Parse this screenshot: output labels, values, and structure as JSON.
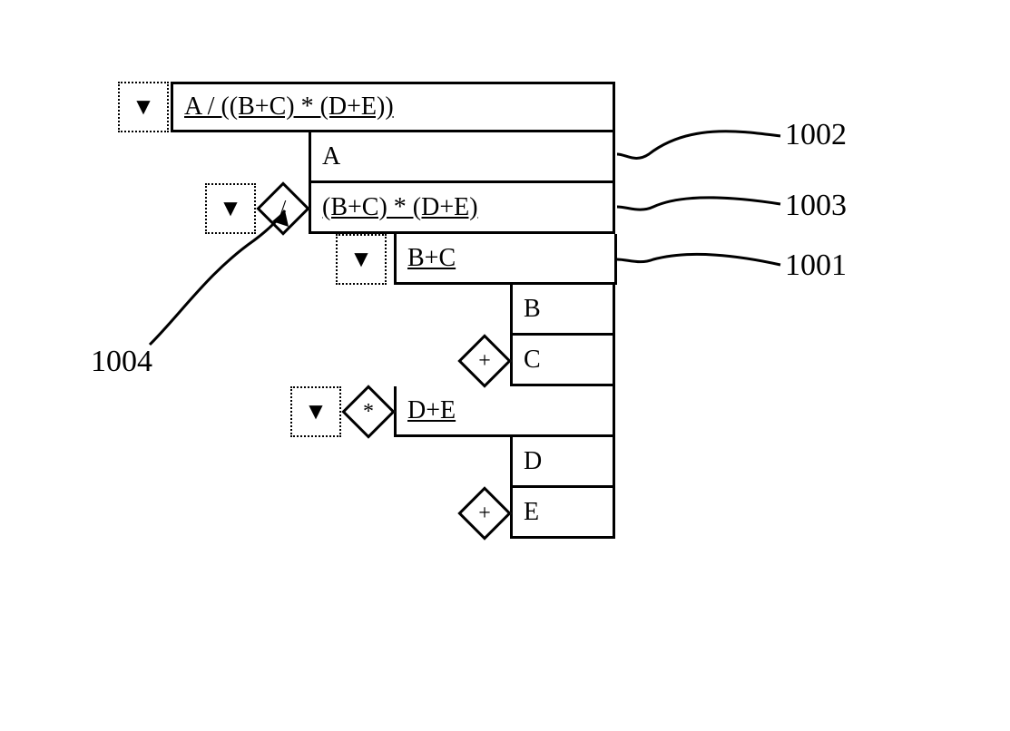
{
  "tree": {
    "root_expr": "A / ((B+C) * (D+E))",
    "node_A": "A",
    "expr_bc_de": "(B+C) * (D+E)",
    "op_div": "/",
    "expr_bc": "B+C",
    "node_B": "B",
    "node_C": "C",
    "op_plus1": "+",
    "op_mul": "*",
    "expr_de": "D+E",
    "node_D": "D",
    "node_E": "E",
    "op_plus2": "+"
  },
  "glyphs": {
    "toggle": "▼"
  },
  "callouts": {
    "c1001": "1001",
    "c1002": "1002",
    "c1003": "1003",
    "c1004": "1004"
  }
}
